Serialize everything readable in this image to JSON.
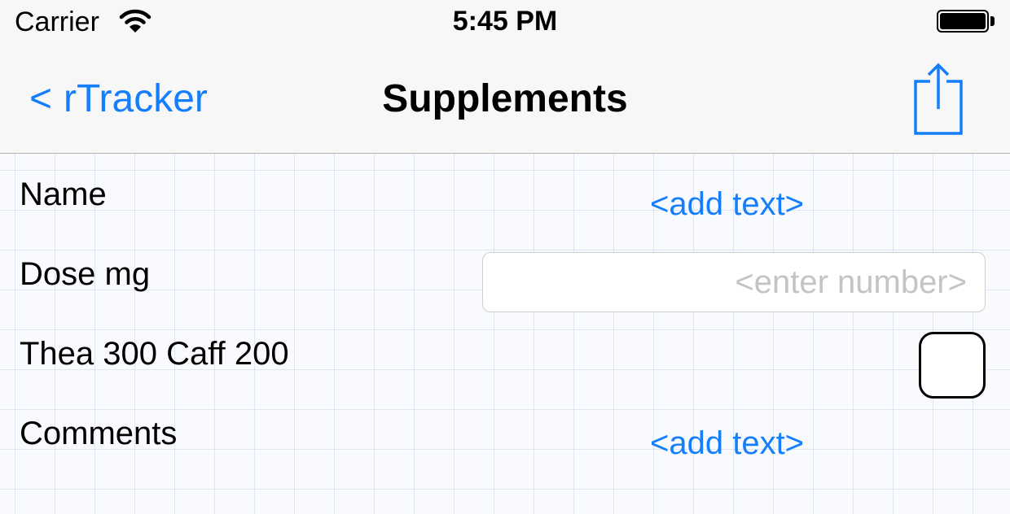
{
  "status_bar": {
    "carrier": "Carrier",
    "time": "5:45 PM",
    "wifi_icon": "wifi-icon",
    "battery_icon": "battery-icon",
    "battery_level": 1.0
  },
  "nav_bar": {
    "back_chevron": "<",
    "back_label": "rTracker",
    "title": "Supplements",
    "share_icon": "share-icon"
  },
  "form": {
    "rows": [
      {
        "label": "Name",
        "type": "text",
        "value": "<add text>"
      },
      {
        "label": "Dose mg",
        "type": "number",
        "value": "",
        "placeholder": "<enter number>"
      },
      {
        "label": "Thea 300 Caff 200",
        "type": "checkbox",
        "checked": false
      },
      {
        "label": "Comments",
        "type": "text",
        "value": "<add text>"
      }
    ]
  },
  "colors": {
    "accent": "#147efb",
    "nav_background": "#f7f7f7",
    "grid_line": "#c9d3ea",
    "placeholder": "#c4c4c8"
  }
}
